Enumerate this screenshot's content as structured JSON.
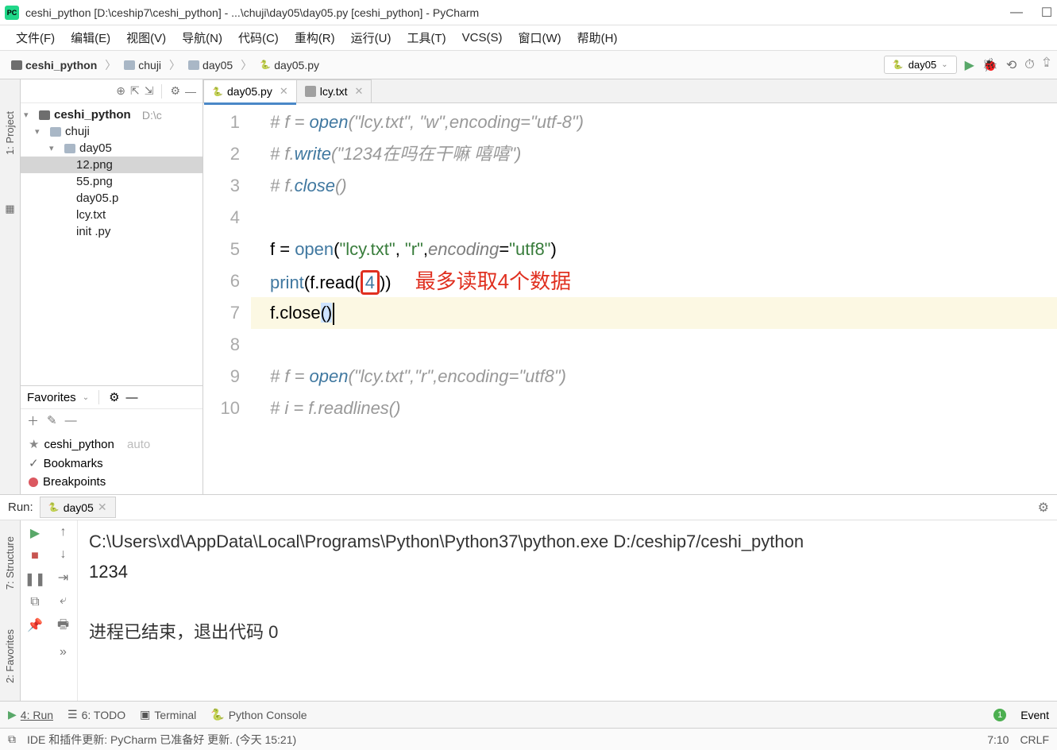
{
  "titlebar": {
    "icon_text": "PC",
    "title": "ceshi_python [D:\\ceship7\\ceshi_python] - ...\\chuji\\day05\\day05.py [ceshi_python] - PyCharm"
  },
  "menu": {
    "file": "文件(F)",
    "edit": "编辑(E)",
    "view": "视图(V)",
    "navigate": "导航(N)",
    "code": "代码(C)",
    "refactor": "重构(R)",
    "run": "运行(U)",
    "tools": "工具(T)",
    "vcs": "VCS(S)",
    "window": "窗口(W)",
    "help": "帮助(H)"
  },
  "breadcrumbs": {
    "root": "ceshi_python",
    "lvl1": "chuji",
    "lvl2": "day05",
    "file": "day05.py"
  },
  "run_config": {
    "name": "day05"
  },
  "left_gutter": {
    "project": "1: Project"
  },
  "tree": {
    "root": "ceshi_python",
    "root_path": "D:\\c",
    "chuji": "chuji",
    "day05": "day05",
    "png12": "12.png",
    "png55": "55.png",
    "daypy": "day05.p",
    "lcy": "lcy.txt",
    "init": "init   .py"
  },
  "favorites": {
    "title": "Favorites",
    "item1": "ceshi_python",
    "item1_dim": "auto",
    "item2": "Bookmarks",
    "item3": "Breakpoints"
  },
  "tabs": {
    "active": "day05.py",
    "second": "lcy.txt"
  },
  "line_numbers": [
    "1",
    "2",
    "3",
    "4",
    "5",
    "6",
    "7",
    "8",
    "9",
    "10"
  ],
  "code": {
    "c1_pre": "# f = ",
    "c1_fn": "open",
    "c1_post": "(\"lcy.txt\", \"w\",encoding=\"utf-8\")",
    "c2_pre": "# f.",
    "c2_fn": "write",
    "c2_post": "(\"1234在吗在干嘛 嘻嘻\")",
    "c3_pre": "# f.",
    "c3_fn": "close",
    "c3_post": "()",
    "l5_var": "f = ",
    "l5_fn": "open",
    "l5_p1": "(",
    "l5_s1": "\"lcy.txt\"",
    "l5_c1": ", ",
    "l5_s2": "\"r\"",
    "l5_c2": ",",
    "l5_kw": "encoding",
    "l5_eq": "=",
    "l5_s3": "\"utf8\"",
    "l5_end": ")",
    "l6_fn": "print",
    "l6_open": "(f.read(",
    "l6_num": "4",
    "l6_close": "))",
    "annotation": "最多读取4个数据",
    "l7_pre": "f.close",
    "l7_par": "()",
    "c9_pre": "# f = ",
    "c9_fn": "open",
    "c9_post": "(\"lcy.txt\",\"r\",encoding=\"utf8\")",
    "c10": "# i = f.readlines()"
  },
  "run_panel": {
    "label": "Run:",
    "tab": "day05",
    "cmd": "C:\\Users\\xd\\AppData\\Local\\Programs\\Python\\Python37\\python.exe D:/ceship7/ceshi_python",
    "output": "1234",
    "exit": "进程已结束，退出代码 0"
  },
  "run_gutter": {
    "structure": "7: Structure",
    "favorites": "2: Favorites"
  },
  "bottom_tools": {
    "run": "4: Run",
    "todo": "6: TODO",
    "terminal": "Terminal",
    "pyconsole": "Python Console",
    "event": "Event"
  },
  "statusbar": {
    "msg": "IDE 和插件更新: PyCharm 已准备好 更新. (今天 15:21)",
    "pos": "7:10",
    "eol": "CRLF"
  },
  "icons": {
    "minimize": "—",
    "maximize": "☐",
    "close_win": "✕",
    "target": "⊕",
    "expand": "⇱",
    "collapse": "⇲",
    "gear": "⚙",
    "hide": "—",
    "chev": "〉",
    "dd": "⌄",
    "play": "▶",
    "bug": "🐞",
    "cover": "⟲",
    "stopwatch": "⏱",
    "find": "⮸",
    "arrow_down": "▾",
    "plus": "＋",
    "pencil": "✎",
    "minus": "—",
    "star": "★",
    "check": "✓",
    "up": "↑",
    "down": "↓",
    "stop": "■",
    "unwrap": "⇥",
    "wrap": "⤶",
    "print": "🖶",
    "pin": "📌",
    "step": "»",
    "todo": "☰",
    "term": "▣",
    "pylogo": "🐍",
    "dblsquare": "⧉"
  }
}
